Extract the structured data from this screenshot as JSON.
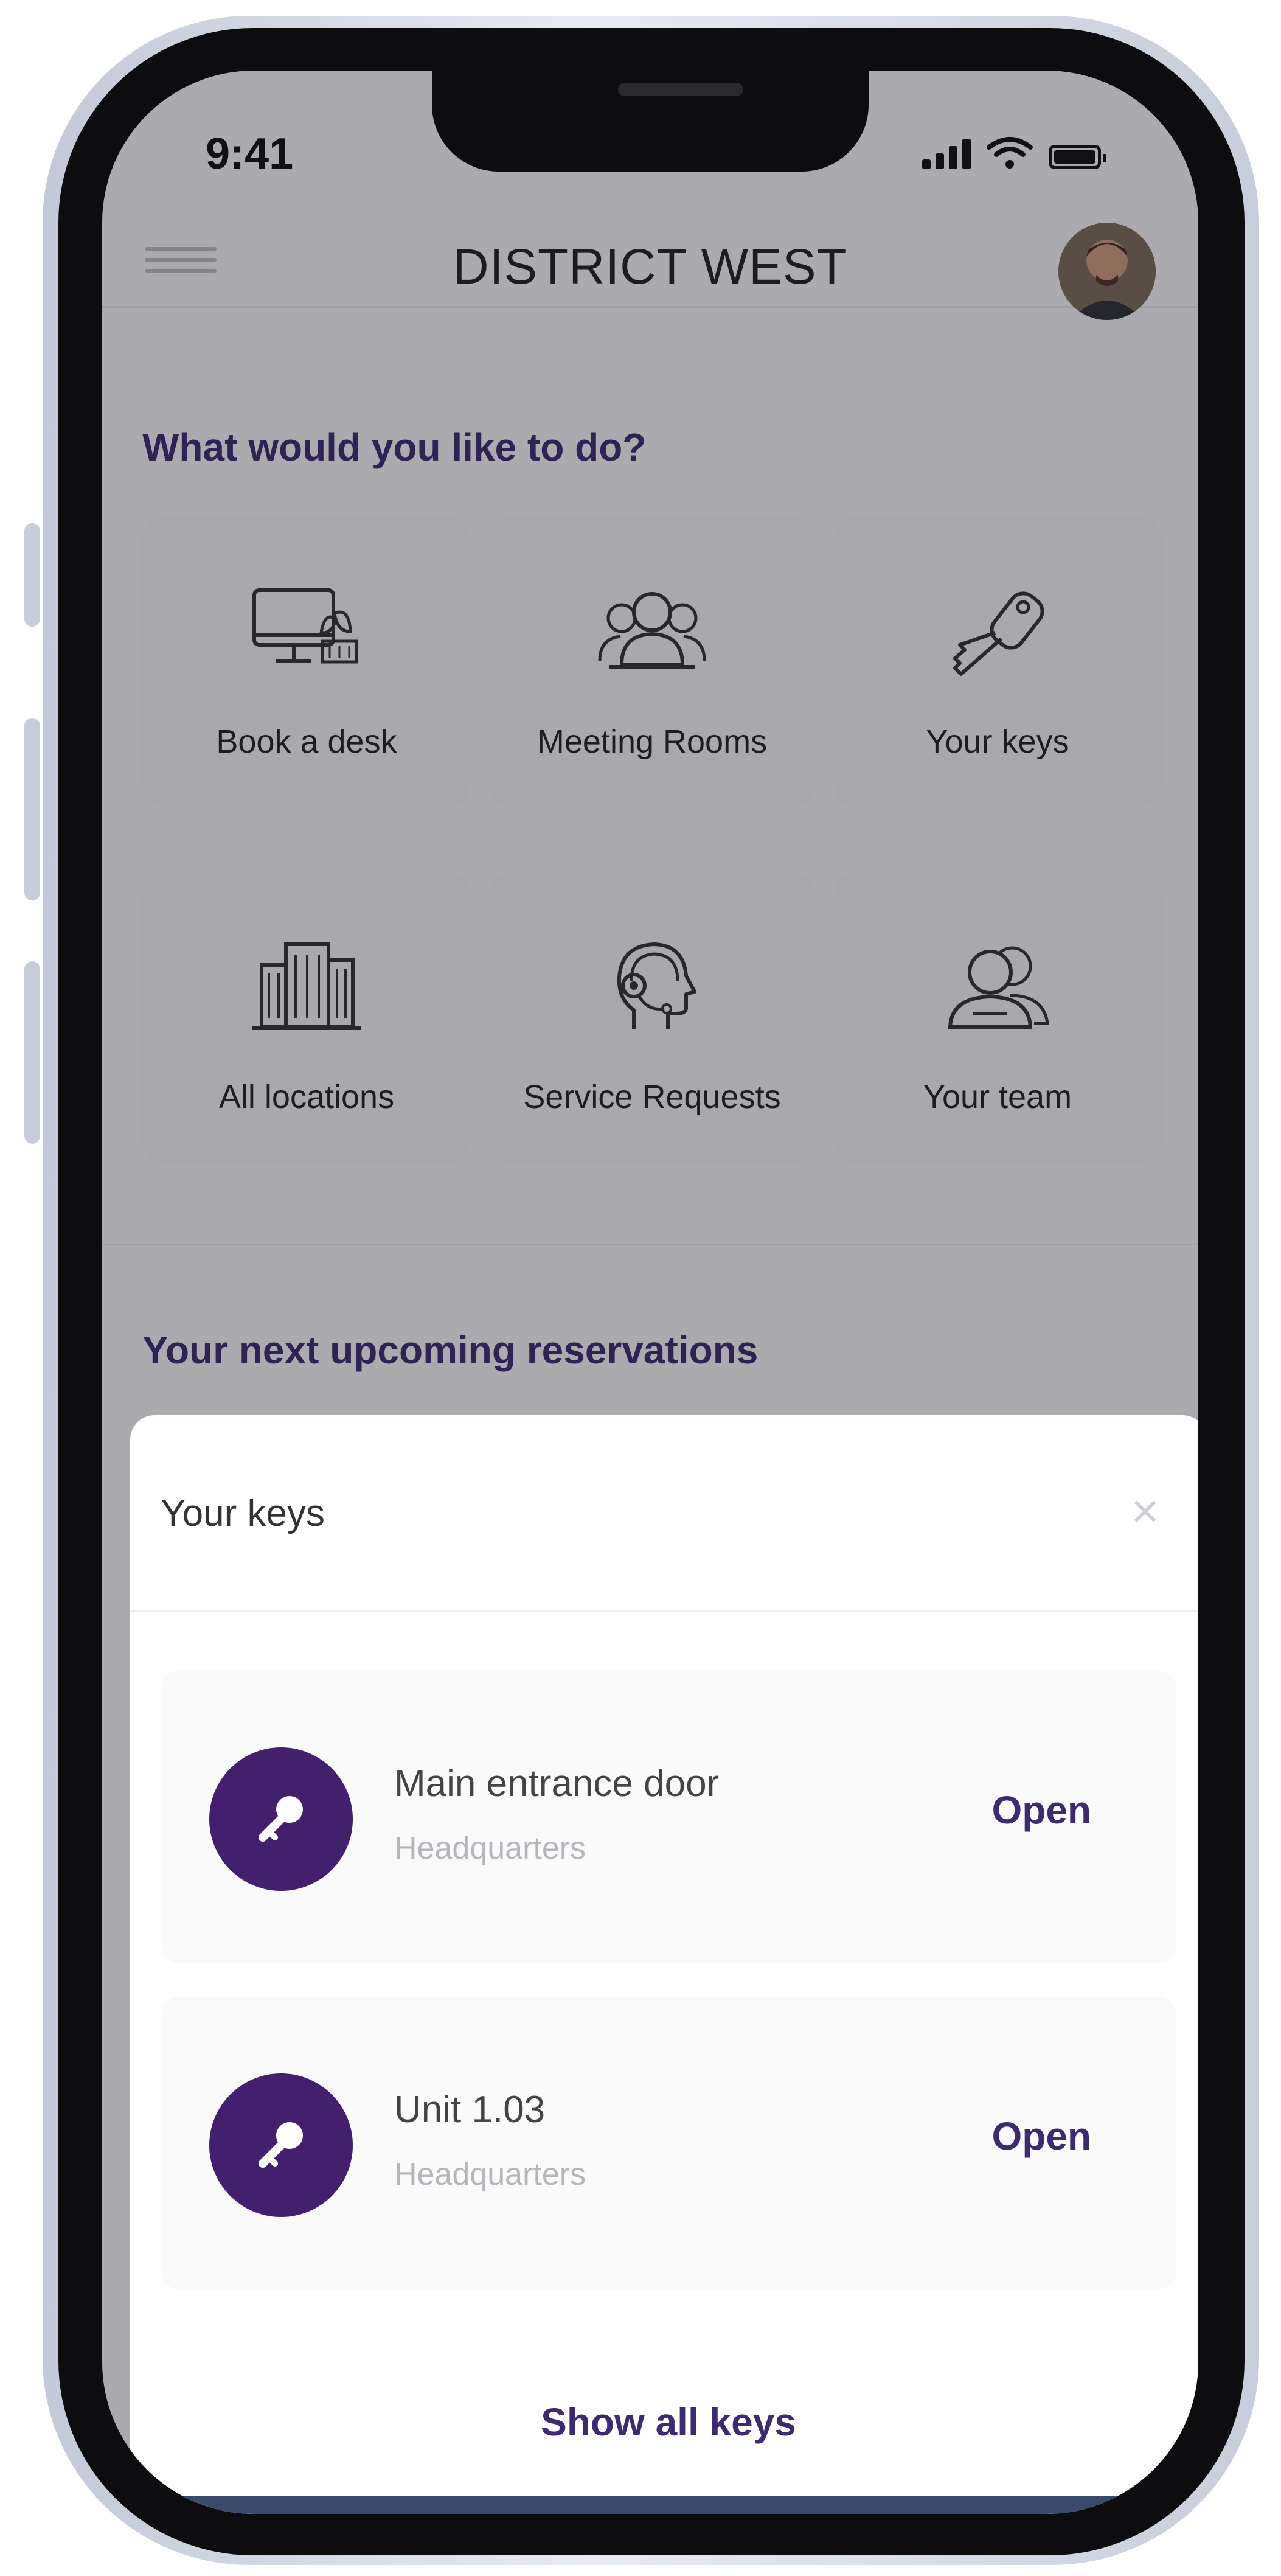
{
  "status_bar": {
    "time": "9:41"
  },
  "header": {
    "title": "DISTRICT WEST"
  },
  "actions": {
    "title": "What would you like to do?",
    "tiles": [
      {
        "label": "Book a desk",
        "icon": "desk-monitor-icon"
      },
      {
        "label": "Meeting Rooms",
        "icon": "meeting-people-icon"
      },
      {
        "label": "Your keys",
        "icon": "key-icon"
      },
      {
        "label": "All locations",
        "icon": "building-icon"
      },
      {
        "label": "Service Requests",
        "icon": "headset-support-icon"
      },
      {
        "label": "Your team",
        "icon": "team-icon"
      }
    ]
  },
  "reservations": {
    "title": "Your next upcoming reservations"
  },
  "keys_sheet": {
    "title": "Your keys",
    "close_icon": "close-icon",
    "keys": [
      {
        "name": "Main entrance door",
        "location": "Headquarters",
        "action": "Open"
      },
      {
        "name": "Unit 1.03",
        "location": "Headquarters",
        "action": "Open"
      }
    ],
    "show_all": "Show all keys"
  },
  "colors": {
    "accent": "#3d2a70",
    "key_badge": "#42206e",
    "tile_bg": "#f1f1f3"
  }
}
